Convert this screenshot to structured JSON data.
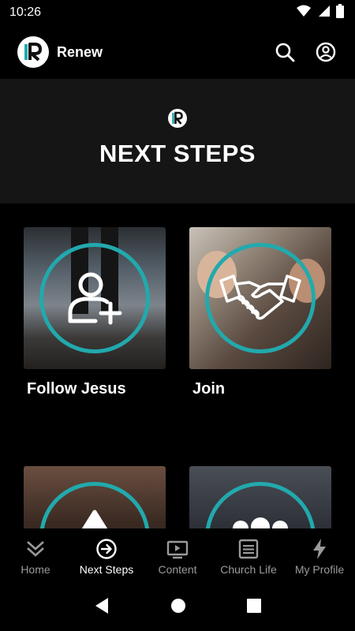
{
  "status_bar": {
    "time": "10:26"
  },
  "app_bar": {
    "title": "Renew",
    "logo_letter": "R"
  },
  "hero": {
    "title": "NEXT STEPS"
  },
  "cards": [
    {
      "label": "Follow Jesus",
      "icon": "add-person-icon"
    },
    {
      "label": "Join",
      "icon": "handshake-icon"
    },
    {
      "label": "",
      "icon": "triangle-icon"
    },
    {
      "label": "",
      "icon": "group-icon"
    }
  ],
  "bottom_nav": [
    {
      "label": "Home",
      "icon": "double-chevron-down-icon",
      "active": false
    },
    {
      "label": "Next Steps",
      "icon": "arrow-circle-right-icon",
      "active": true
    },
    {
      "label": "Content",
      "icon": "tv-play-icon",
      "active": false
    },
    {
      "label": "Church Life",
      "icon": "bulletin-icon",
      "active": false
    },
    {
      "label": "My Profile",
      "icon": "lightning-icon",
      "active": false
    }
  ],
  "colors": {
    "accent": "#22a9ad",
    "background": "#000000",
    "hero_bg": "#151515",
    "nav_inactive": "#9a9a9a"
  }
}
